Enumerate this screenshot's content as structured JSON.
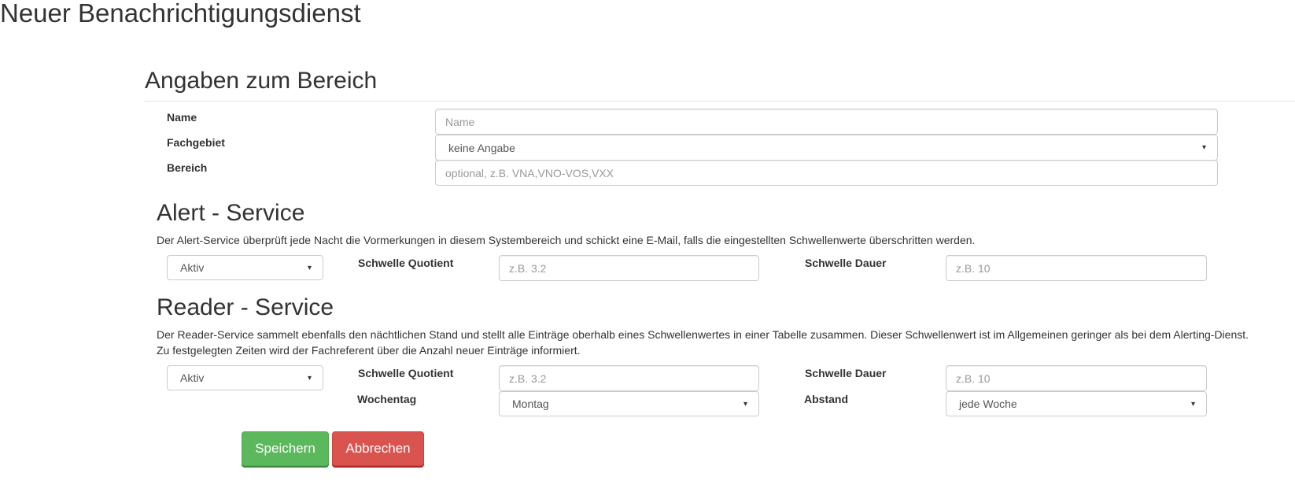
{
  "page": {
    "title": "Neuer Benachrichtigungsdienst"
  },
  "bereich": {
    "heading": "Angaben zum Bereich",
    "name_label": "Name",
    "name_placeholder": "Name",
    "fachgebiet_label": "Fachgebiet",
    "fachgebiet_value": "keine Angabe",
    "bereich_label": "Bereich",
    "bereich_placeholder": "optional, z.B. VNA,VNO-VOS,VXX"
  },
  "alert": {
    "heading": "Alert - Service",
    "description": "Der Alert-Service überprüft jede Nacht die Vormerkungen in diesem Systembereich und schickt eine E-Mail, falls die eingestellten Schwellenwerte überschritten werden.",
    "status_value": "Aktiv",
    "quotient_label": "Schwelle Quotient",
    "quotient_placeholder": "z.B. 3.2",
    "dauer_label": "Schwelle Dauer",
    "dauer_placeholder": "z.B. 10"
  },
  "reader": {
    "heading": "Reader - Service",
    "description_line1": "Der Reader-Service sammelt ebenfalls den nächtlichen Stand und stellt alle Einträge oberhalb eines Schwellenwertes in einer Tabelle zusammen. Dieser Schwellenwert ist im Allgemeinen geringer als bei dem Alerting-Dienst.",
    "description_line2": "Zu festgelegten Zeiten wird der Fachreferent über die Anzahl neuer Einträge informiert.",
    "status_value": "Aktiv",
    "quotient_label": "Schwelle Quotient",
    "quotient_placeholder": "z.B. 3.2",
    "dauer_label": "Schwelle Dauer",
    "dauer_placeholder": "z.B. 10",
    "wochentag_label": "Wochentag",
    "wochentag_value": "Montag",
    "abstand_label": "Abstand",
    "abstand_value": "jede Woche"
  },
  "actions": {
    "save_label": "Speichern",
    "cancel_label": "Abbrechen"
  },
  "icons": {
    "caret": "▾"
  },
  "colors": {
    "save": "#5cb85c",
    "cancel": "#d9534f"
  }
}
